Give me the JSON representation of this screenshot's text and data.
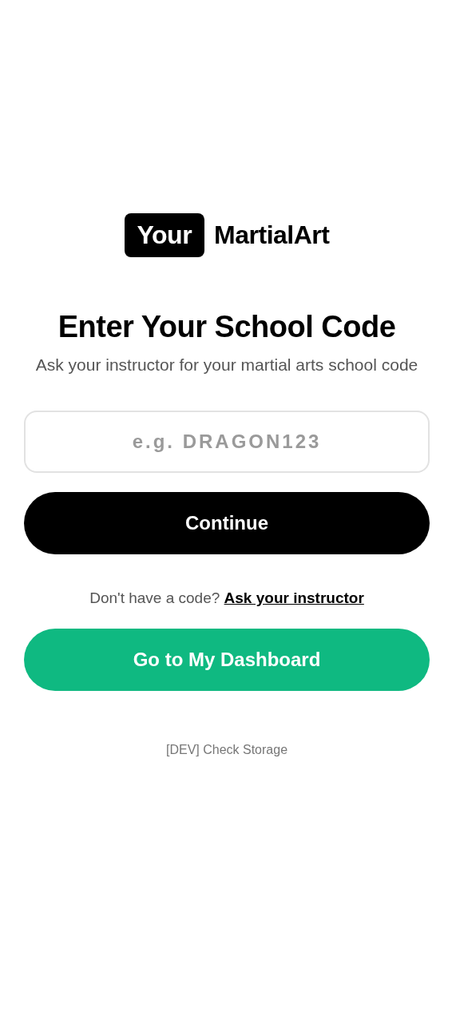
{
  "logo": {
    "badge": "Your",
    "name": "MartialArt"
  },
  "title": "Enter Your School Code",
  "subtitle": "Ask your instructor for your martial arts school code",
  "code_field": {
    "placeholder": "e.g. DRAGON123"
  },
  "continue_button": "Continue",
  "help": {
    "text": "Don't have a code?",
    "link": "Ask your instructor"
  },
  "dashboard_button": "Go to My Dashboard",
  "dev_link": "[DEV] Check Storage"
}
